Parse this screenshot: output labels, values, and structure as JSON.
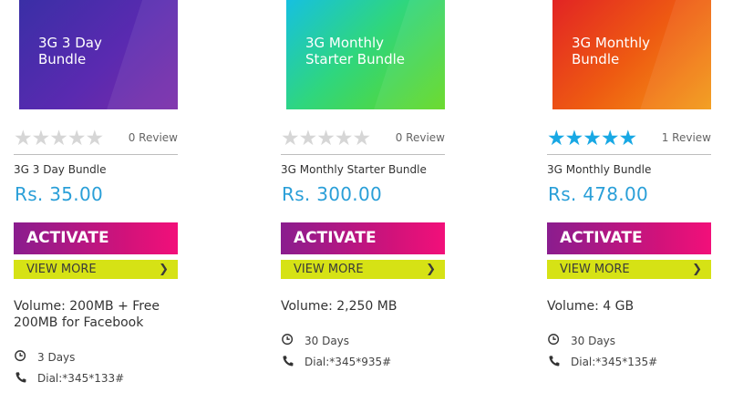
{
  "products": [
    {
      "banner_title": "3G 3 Day\nBundle",
      "stars_filled": 0,
      "stars_total": 5,
      "reviews": "0 Review",
      "name": "3G 3 Day Bundle",
      "price": "Rs. 35.00",
      "activate_label": "ACTIVATE",
      "view_more_label": "VIEW MORE",
      "chevron": "❯",
      "volume": "Volume: 200MB + Free 200MB for Facebook",
      "validity": "3 Days",
      "dial": "Dial:*345*133#"
    },
    {
      "banner_title": "3G Monthly\nStarter Bundle",
      "stars_filled": 0,
      "stars_total": 5,
      "reviews": "0 Review",
      "name": "3G Monthly Starter Bundle",
      "price": "Rs. 300.00",
      "activate_label": "ACTIVATE",
      "view_more_label": "VIEW MORE",
      "chevron": "❯",
      "volume": "Volume: 2,250 MB",
      "validity": "30 Days",
      "dial": "Dial:*345*935#"
    },
    {
      "banner_title": "3G Monthly\nBundle",
      "stars_filled": 5,
      "stars_total": 5,
      "reviews": "1 Review",
      "name": "3G Monthly Bundle",
      "price": "Rs. 478.00",
      "activate_label": "ACTIVATE",
      "view_more_label": "VIEW MORE",
      "chevron": "❯",
      "volume": "Volume: 4 GB",
      "validity": "30 Days",
      "dial": "Dial:*345*135#"
    }
  ],
  "colors": {
    "price": "#2a9fd8",
    "star_filled": "#18a8e4",
    "star_empty": "#d6d6d6",
    "activate_start": "#8a1d8e",
    "activate_end": "#f2107a",
    "view_more_bg": "#d6e215"
  },
  "icons": {
    "validity": "clock-icon",
    "dial": "phone-icon"
  }
}
